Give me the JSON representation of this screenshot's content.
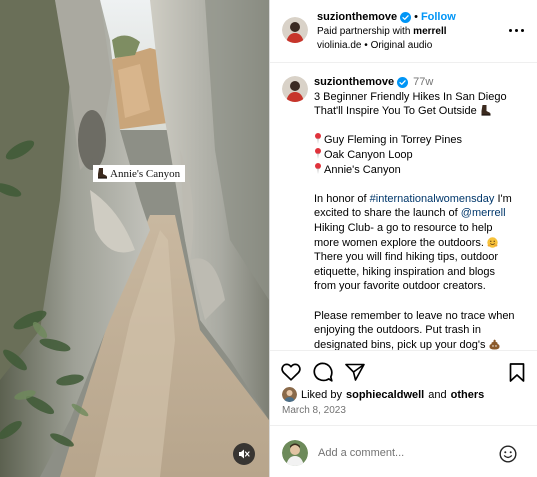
{
  "media": {
    "location_label": "Annie's Canyon",
    "mute_icon": "speaker-muted-icon"
  },
  "header": {
    "username": "suzionthemove",
    "separator": "•",
    "follow_label": "Follow",
    "partnership_prefix": "Paid partnership with",
    "partner": "merrell",
    "audio_source": "violinia.de",
    "audio_separator": "•",
    "audio_label": "Original audio",
    "more_icon": "more-options-icon"
  },
  "caption": {
    "username": "suzionthemove",
    "age": "77w",
    "title_line1": "3 Beginner Friendly Hikes In San Diego",
    "title_line2": "That'll Inspire You To Get Outside",
    "hikes": [
      "Guy Fleming in Torrey Pines",
      "Oak Canyon Loop",
      "Annie's Canyon"
    ],
    "p1_l1_pre": "In honor of",
    "p1_hashtag": "#internationalwomensday",
    "p1_l1_post": "I'm",
    "p1_l2_pre": "excited to share the launch of",
    "p1_mention": "@merrell",
    "p1_l3": "Hiking Club- a go to resource to help",
    "p1_l4": "more women explore the outdoors.",
    "p1_l5": "There you will find hiking tips, outdoor",
    "p1_l6": "etiquette, hiking inspiration and blogs",
    "p1_l7": "from your favorite outdoor creators.",
    "p2_l1": "Please remember to leave no trace when",
    "p2_l2": "enjoying the outdoors. Put trash in",
    "p2_l3": "designated bins, pick up your dog's"
  },
  "actions": {
    "like_icon": "heart-icon",
    "comment_icon": "comment-icon",
    "share_icon": "share-icon",
    "save_icon": "bookmark-icon"
  },
  "likes": {
    "prefix": "Liked by",
    "user": "sophiecaldwell",
    "conjunction": "and",
    "others": "others"
  },
  "post_date": "March 8, 2023",
  "comment": {
    "placeholder": "Add a comment...",
    "emoji_icon": "smiley-icon"
  },
  "colors": {
    "link_blue": "#0095f6",
    "hashtag_blue": "#00376b",
    "secondary_text": "#737373",
    "verified_blue": "#0095f6"
  }
}
